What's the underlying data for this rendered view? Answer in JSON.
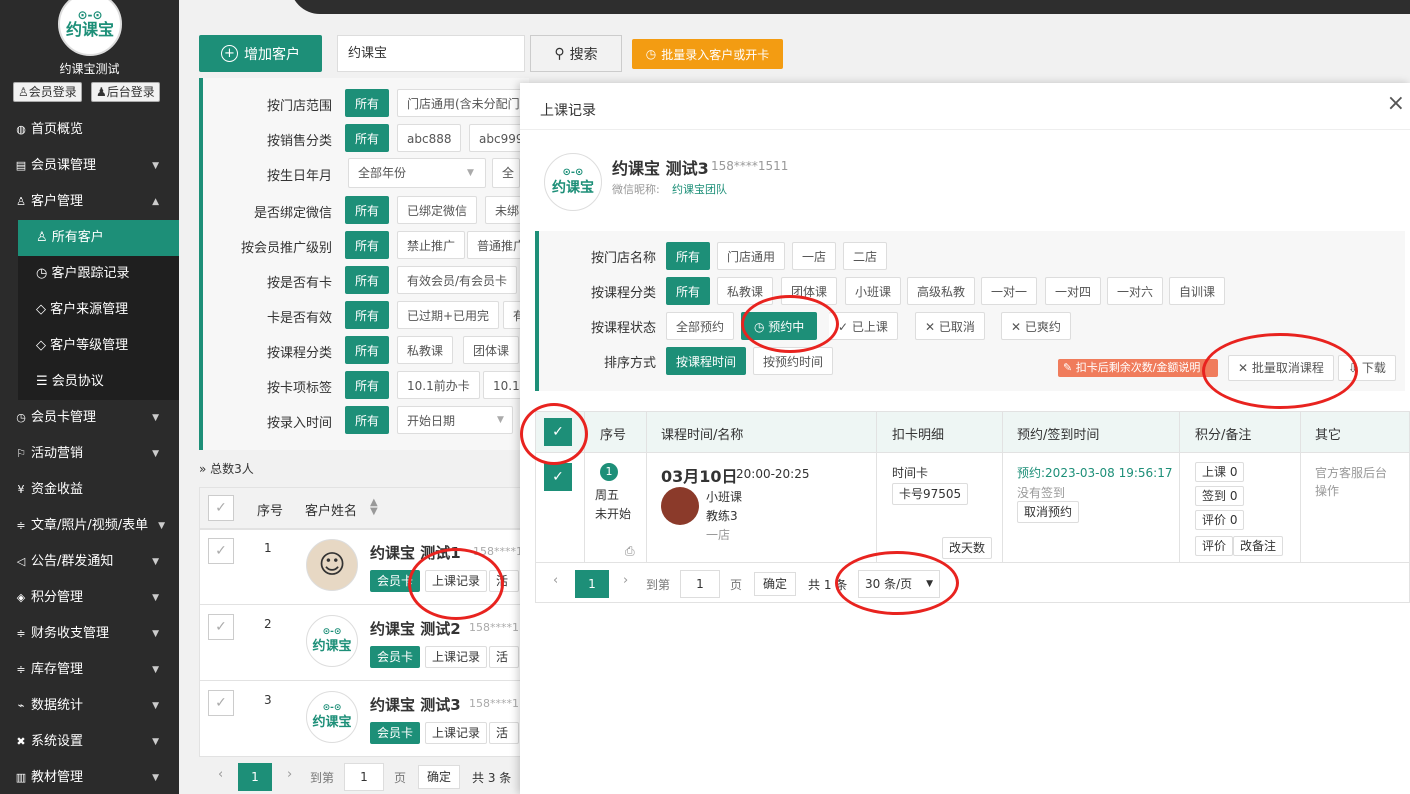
{
  "sidebar": {
    "logo_eyes": "⊙-⊙",
    "logo_text": "约课宝",
    "user_name": "约课宝测试",
    "member_login": "会员登录",
    "admin_login": "后台登录",
    "items": [
      {
        "label": "首页概览",
        "icon": "globe-icon"
      },
      {
        "label": "会员课管理",
        "icon": "doc-icon"
      },
      {
        "label": "客户管理",
        "icon": "user-icon"
      },
      {
        "label": "会员卡管理",
        "icon": "clock-icon"
      },
      {
        "label": "活动营销",
        "icon": "flag-icon"
      },
      {
        "label": "资金收益",
        "icon": "yen-icon"
      },
      {
        "label": "文章/照片/视频/表单",
        "icon": "sliders-icon"
      },
      {
        "label": "公告/群发通知",
        "icon": "speaker-icon"
      },
      {
        "label": "积分管理",
        "icon": "diamond-icon"
      },
      {
        "label": "财务收支管理",
        "icon": "sliders-icon"
      },
      {
        "label": "库存管理",
        "icon": "sliders-icon"
      },
      {
        "label": "数据统计",
        "icon": "pulse-icon"
      },
      {
        "label": "系统设置",
        "icon": "tools-icon"
      },
      {
        "label": "教材管理",
        "icon": "book-icon"
      }
    ],
    "subitems": [
      {
        "label": "所有客户",
        "icon": "user-icon"
      },
      {
        "label": "客户跟踪记录",
        "icon": "clock-icon"
      },
      {
        "label": "客户来源管理",
        "icon": "tag-icon"
      },
      {
        "label": "客户等级管理",
        "icon": "tag-icon"
      },
      {
        "label": "会员协议",
        "icon": "layers-icon"
      }
    ]
  },
  "toolbar": {
    "add_customer": "增加客户",
    "search_value": "约课宝",
    "search_label": "搜索",
    "batch_label": "批量录入客户或开卡"
  },
  "filters": [
    {
      "label": "按门店范围",
      "options": [
        "所有",
        "门店通用(含未分配门"
      ]
    },
    {
      "label": "按销售分类",
      "options": [
        "所有",
        "abc888",
        "abc999"
      ]
    },
    {
      "label": "按生日年月",
      "select": "全部年份",
      "extra": "全"
    },
    {
      "label": "是否绑定微信",
      "options": [
        "所有",
        "已绑定微信",
        "未绑"
      ]
    },
    {
      "label": "按会员推广级别",
      "options": [
        "所有",
        "禁止推广",
        "普通推广"
      ]
    },
    {
      "label": "按是否有卡",
      "options": [
        "所有",
        "有效会员/有会员卡"
      ]
    },
    {
      "label": "卡是否有效",
      "options": [
        "所有",
        "已过期+已用完",
        "有"
      ]
    },
    {
      "label": "按课程分类",
      "options": [
        "所有",
        "私教课",
        "团体课"
      ]
    },
    {
      "label": "按卡项标签",
      "options": [
        "所有",
        "10.1前办卡",
        "10.1"
      ]
    },
    {
      "label": "按录入时间",
      "options": [
        "所有"
      ],
      "select": "开始日期"
    }
  ],
  "list": {
    "total": "总数3人",
    "col_index": "序号",
    "col_name": "客户姓名",
    "rows": [
      {
        "index": "1",
        "name": "约课宝 测试1",
        "phone": "158****1",
        "card": "会员卡",
        "records": "上课记录",
        "activity": "活动"
      },
      {
        "index": "2",
        "name": "约课宝 测试2",
        "phone": "158****1",
        "card": "会员卡",
        "records": "上课记录",
        "activity": "活动"
      },
      {
        "index": "3",
        "name": "约课宝 测试3",
        "phone": "158****1",
        "card": "会员卡",
        "records": "上课记录",
        "activity": "活动"
      }
    ],
    "pager": {
      "current": "1",
      "goto": "到第",
      "page_value": "1",
      "page_unit": "页",
      "confirm": "确定",
      "total": "共 3 条"
    }
  },
  "modal": {
    "title": "上课记录",
    "close": "×",
    "customer_name": "约课宝 测试3",
    "customer_phone": "158****1511",
    "wechat_label": "微信昵称:",
    "wechat_value": "约课宝团队",
    "filters": {
      "store": {
        "label": "按门店名称",
        "options": [
          "所有",
          "门店通用",
          "一店",
          "二店"
        ]
      },
      "category": {
        "label": "按课程分类",
        "options": [
          "所有",
          "私教课",
          "团体课",
          "小班课",
          "高级私教",
          "一对一",
          "一对四",
          "一对六",
          "自训课"
        ]
      },
      "status": {
        "label": "按课程状态",
        "options": [
          "全部预约",
          "预约中",
          "已上课",
          "已取消",
          "已爽约"
        ]
      },
      "sort": {
        "label": "排序方式",
        "options": [
          "按课程时间",
          "按预约时间"
        ]
      }
    },
    "notice": "扣卡后剩余次数/金额说明",
    "batch_cancel": "批量取消课程",
    "download": "下载",
    "columns": [
      "序号",
      "课程时间/名称",
      "扣卡明细",
      "预约/签到时间",
      "积分/备注",
      "其它"
    ],
    "row": {
      "index": "1",
      "weekday": "周五",
      "status": "未开始",
      "date": "03月10日",
      "time": "20:00-20:25",
      "course": "小班课",
      "coach": "教练3",
      "store": "一店",
      "card_type": "时间卡",
      "card_no": "卡号97505",
      "change_days": "改天数",
      "booked": "预约:2023-03-08 19:56:17",
      "not_signed": "没有签到",
      "cancel_booking": "取消预约",
      "class_points": "上课 0",
      "sign_points": "签到 0",
      "review_points": "评价 0",
      "review": "评价",
      "edit_note": "改备注",
      "other": "官方客服后台操作"
    },
    "pager": {
      "current": "1",
      "goto": "到第",
      "page_value": "1",
      "page_unit": "页",
      "confirm": "确定",
      "total": "共 1 条",
      "per_page": "30 条/页"
    }
  },
  "colors": {
    "accent": "#1d8f78",
    "sidebar": "#2b2b2b",
    "highlight_red": "#e8231f",
    "orange": "#f39c12"
  }
}
